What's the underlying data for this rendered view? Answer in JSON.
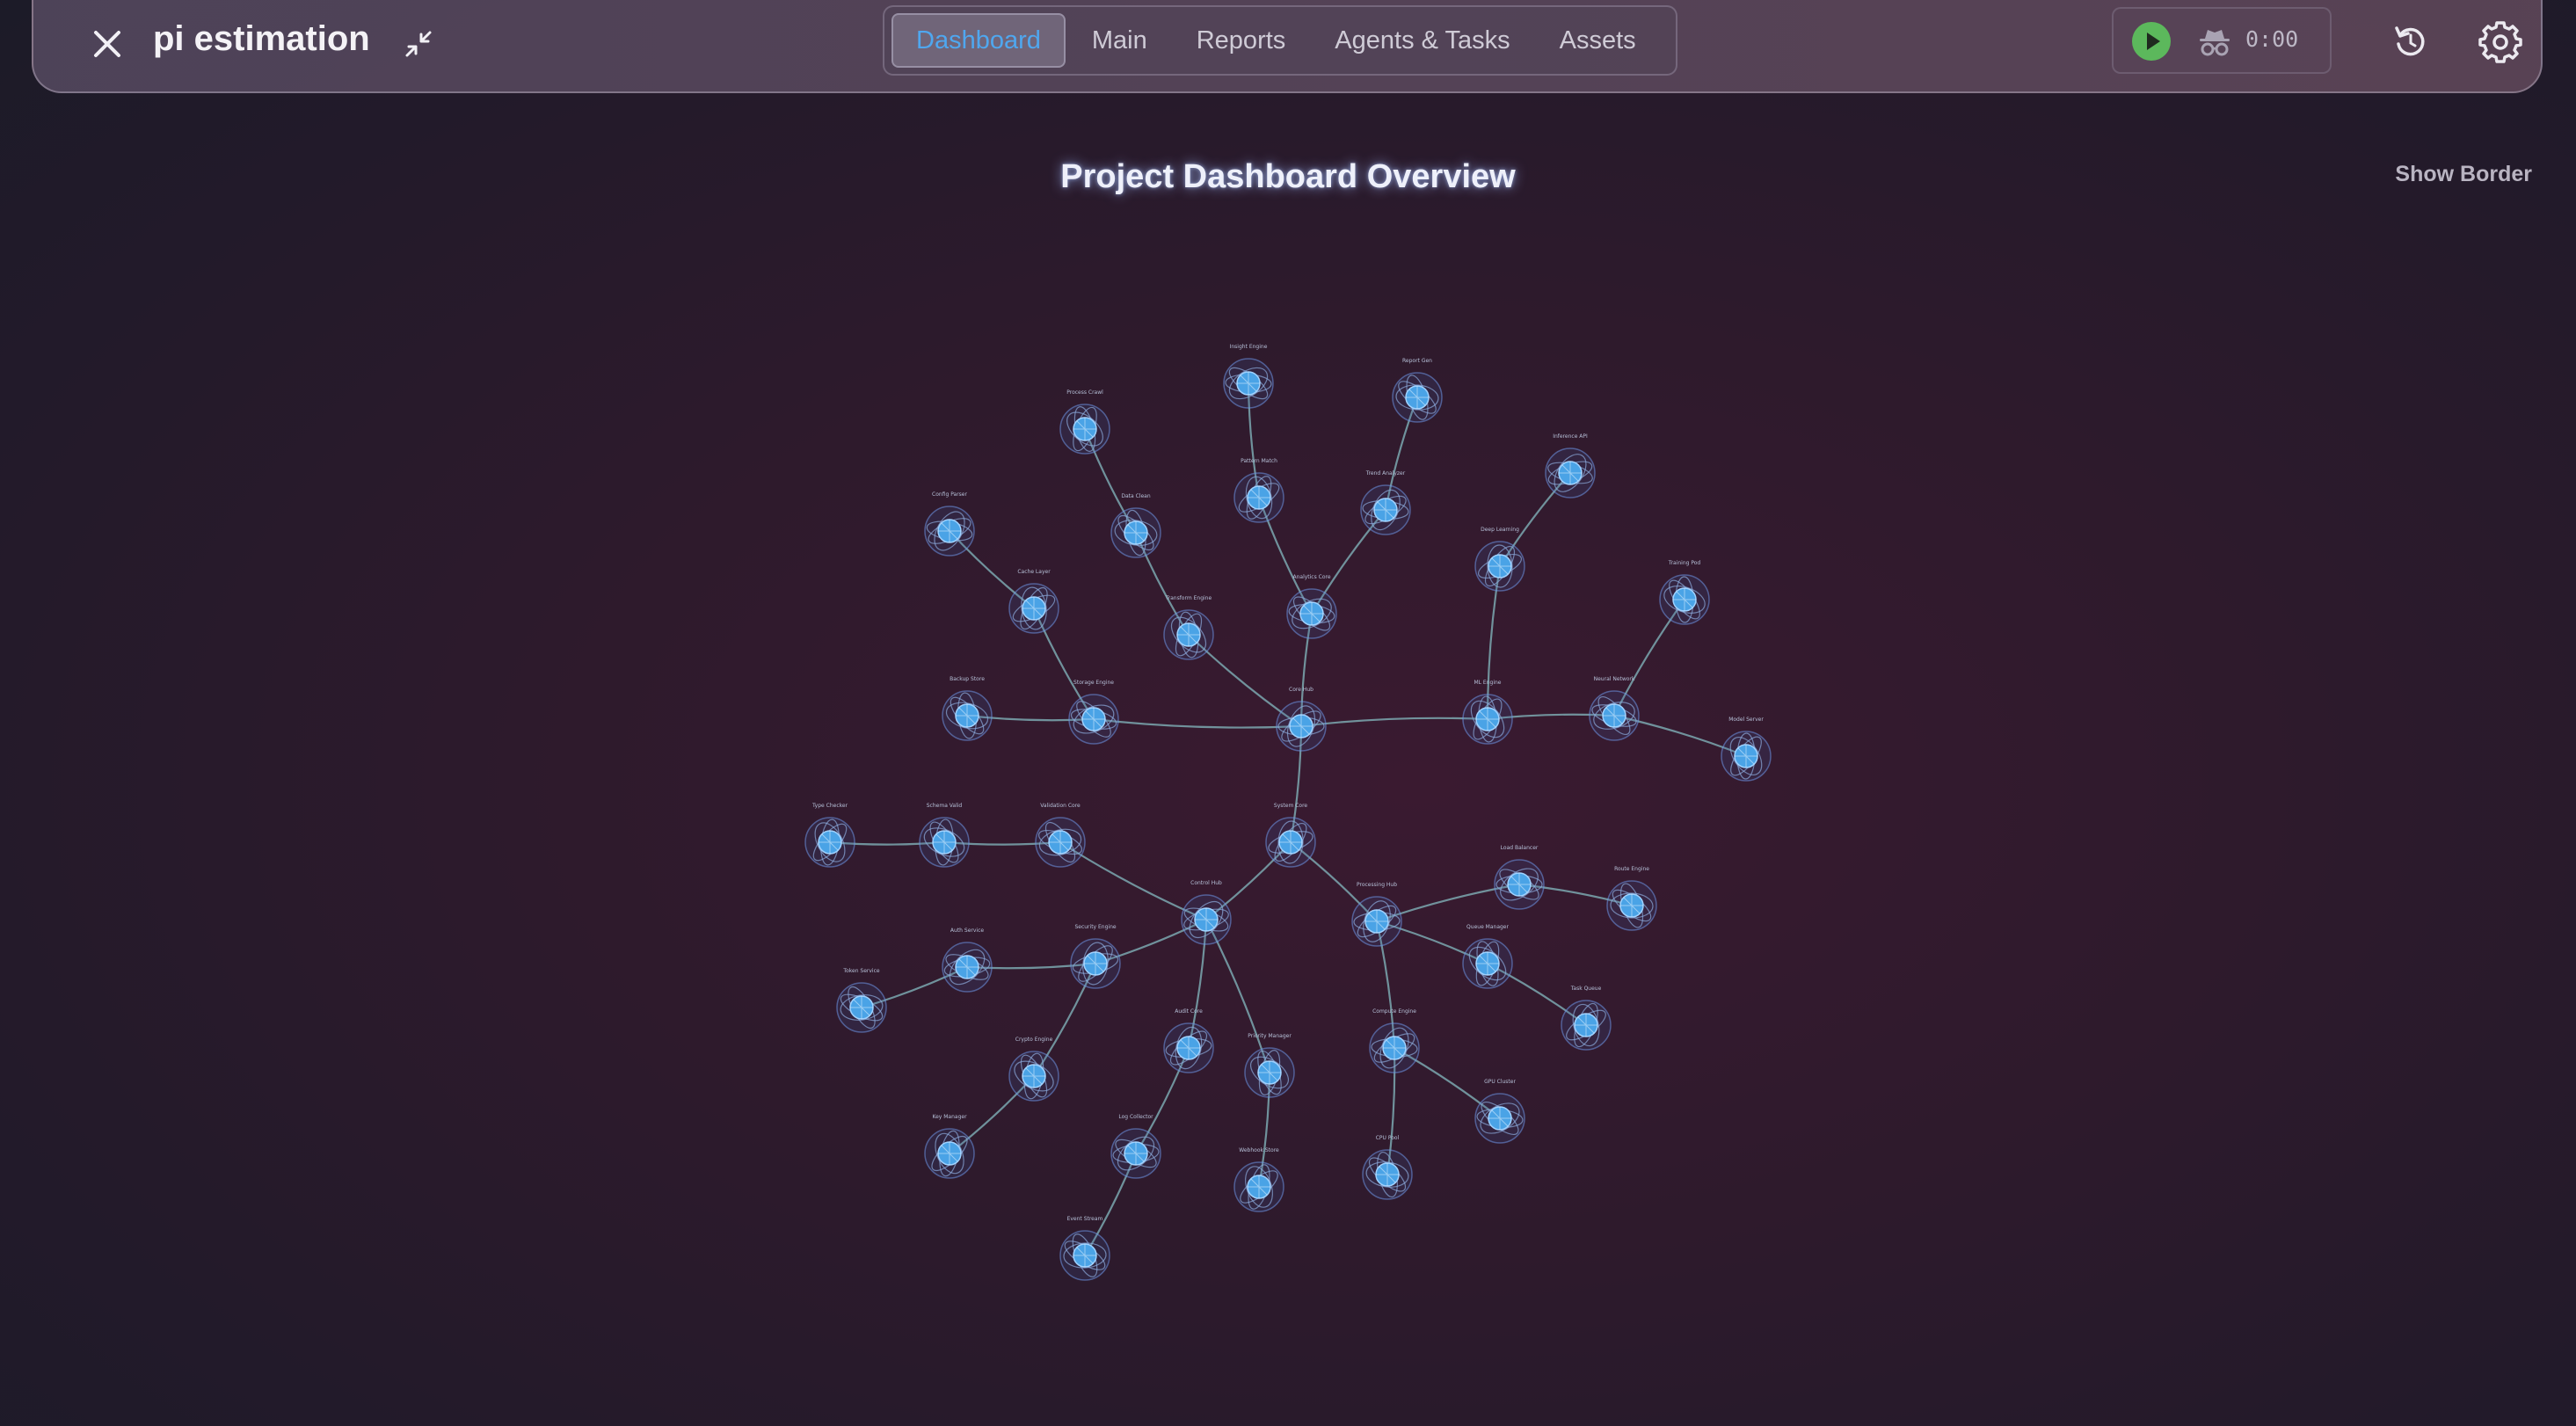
{
  "header": {
    "title": "pi estimation",
    "tabs": [
      {
        "label": "Dashboard",
        "active": true
      },
      {
        "label": "Main",
        "active": false
      },
      {
        "label": "Reports",
        "active": false
      },
      {
        "label": "Agents & Tasks",
        "active": false
      },
      {
        "label": "Assets",
        "active": false
      }
    ],
    "timer": "0:00",
    "icons": {
      "close": "close-icon",
      "collapse": "collapse-icon",
      "play": "play-icon",
      "incognito": "incognito-icon",
      "reset": "reset-icon",
      "settings": "gear-icon"
    },
    "colors": {
      "active_tab": "#4fa7ef",
      "play": "#5cb85c"
    }
  },
  "dashboard": {
    "title": "Project Dashboard Overview",
    "show_border_label": "Show Border"
  },
  "graph": {
    "node_color": "#4aa3e6",
    "edge_color": "#7fb0b8",
    "nodes": [
      {
        "id": "core-hub",
        "label": "Core Hub"
      },
      {
        "id": "insight-engine",
        "label": "Insight Engine"
      },
      {
        "id": "report-gen",
        "label": "Report Gen"
      },
      {
        "id": "process-crawl",
        "label": "Process Crawl"
      },
      {
        "id": "pattern-match",
        "label": "Pattern Match"
      },
      {
        "id": "trend-analyzer",
        "label": "Trend Analyzer"
      },
      {
        "id": "analytics-core",
        "label": "Analytics Core"
      },
      {
        "id": "data-clean",
        "label": "Data Clean"
      },
      {
        "id": "transform-engine",
        "label": "Transform Engine"
      },
      {
        "id": "cache-layer",
        "label": "Cache Layer"
      },
      {
        "id": "config-parser",
        "label": "Config Parser"
      },
      {
        "id": "storage-engine",
        "label": "Storage Engine"
      },
      {
        "id": "backup-store",
        "label": "Backup Store"
      },
      {
        "id": "ml-engine",
        "label": "ML Engine"
      },
      {
        "id": "deep-learning",
        "label": "Deep Learning"
      },
      {
        "id": "inference-api",
        "label": "Inference API"
      },
      {
        "id": "neural-network",
        "label": "Neural Network"
      },
      {
        "id": "training-pod",
        "label": "Training Pod"
      },
      {
        "id": "model-server",
        "label": "Model Server"
      },
      {
        "id": "system-core",
        "label": "System Core"
      },
      {
        "id": "control-hub",
        "label": "Control Hub"
      },
      {
        "id": "validation-core",
        "label": "Validation Core"
      },
      {
        "id": "schema-valid",
        "label": "Schema Valid"
      },
      {
        "id": "type-checker",
        "label": "Type Checker"
      },
      {
        "id": "security-engine",
        "label": "Security Engine"
      },
      {
        "id": "auth-service",
        "label": "Auth Service"
      },
      {
        "id": "token-service",
        "label": "Token Service"
      },
      {
        "id": "crypto-engine",
        "label": "Crypto Engine"
      },
      {
        "id": "key-manager",
        "label": "Key Manager"
      },
      {
        "id": "audit-core",
        "label": "Audit Core"
      },
      {
        "id": "log-collector",
        "label": "Log Collector"
      },
      {
        "id": "event-stream",
        "label": "Event Stream"
      },
      {
        "id": "priority-manager",
        "label": "Priority Manager"
      },
      {
        "id": "webhook-store",
        "label": "Webhook Store"
      },
      {
        "id": "processing-hub",
        "label": "Processing Hub"
      },
      {
        "id": "load-balancer",
        "label": "Load Balancer"
      },
      {
        "id": "route-engine",
        "label": "Route Engine"
      },
      {
        "id": "queue-manager",
        "label": "Queue Manager"
      },
      {
        "id": "task-queue",
        "label": "Task Queue"
      },
      {
        "id": "compute-engine",
        "label": "Compute Engine"
      },
      {
        "id": "gpu-cluster",
        "label": "GPU Cluster"
      },
      {
        "id": "cpu-pool",
        "label": "CPU Pool"
      }
    ],
    "edges": [
      [
        "core-hub",
        "analytics-core"
      ],
      [
        "analytics-core",
        "pattern-match"
      ],
      [
        "pattern-match",
        "insight-engine"
      ],
      [
        "analytics-core",
        "trend-analyzer"
      ],
      [
        "trend-analyzer",
        "report-gen"
      ],
      [
        "core-hub",
        "transform-engine"
      ],
      [
        "transform-engine",
        "data-clean"
      ],
      [
        "data-clean",
        "process-crawl"
      ],
      [
        "core-hub",
        "storage-engine"
      ],
      [
        "storage-engine",
        "cache-layer"
      ],
      [
        "cache-layer",
        "config-parser"
      ],
      [
        "storage-engine",
        "backup-store"
      ],
      [
        "core-hub",
        "ml-engine"
      ],
      [
        "ml-engine",
        "deep-learning"
      ],
      [
        "deep-learning",
        "inference-api"
      ],
      [
        "ml-engine",
        "neural-network"
      ],
      [
        "neural-network",
        "training-pod"
      ],
      [
        "neural-network",
        "model-server"
      ],
      [
        "core-hub",
        "system-core"
      ],
      [
        "system-core",
        "control-hub"
      ],
      [
        "control-hub",
        "validation-core"
      ],
      [
        "validation-core",
        "schema-valid"
      ],
      [
        "schema-valid",
        "type-checker"
      ],
      [
        "control-hub",
        "security-engine"
      ],
      [
        "security-engine",
        "auth-service"
      ],
      [
        "auth-service",
        "token-service"
      ],
      [
        "security-engine",
        "crypto-engine"
      ],
      [
        "crypto-engine",
        "key-manager"
      ],
      [
        "control-hub",
        "audit-core"
      ],
      [
        "audit-core",
        "log-collector"
      ],
      [
        "log-collector",
        "event-stream"
      ],
      [
        "control-hub",
        "priority-manager"
      ],
      [
        "priority-manager",
        "webhook-store"
      ],
      [
        "system-core",
        "processing-hub"
      ],
      [
        "processing-hub",
        "load-balancer"
      ],
      [
        "load-balancer",
        "route-engine"
      ],
      [
        "processing-hub",
        "queue-manager"
      ],
      [
        "queue-manager",
        "task-queue"
      ],
      [
        "processing-hub",
        "compute-engine"
      ],
      [
        "compute-engine",
        "gpu-cluster"
      ],
      [
        "compute-engine",
        "cpu-pool"
      ]
    ]
  }
}
